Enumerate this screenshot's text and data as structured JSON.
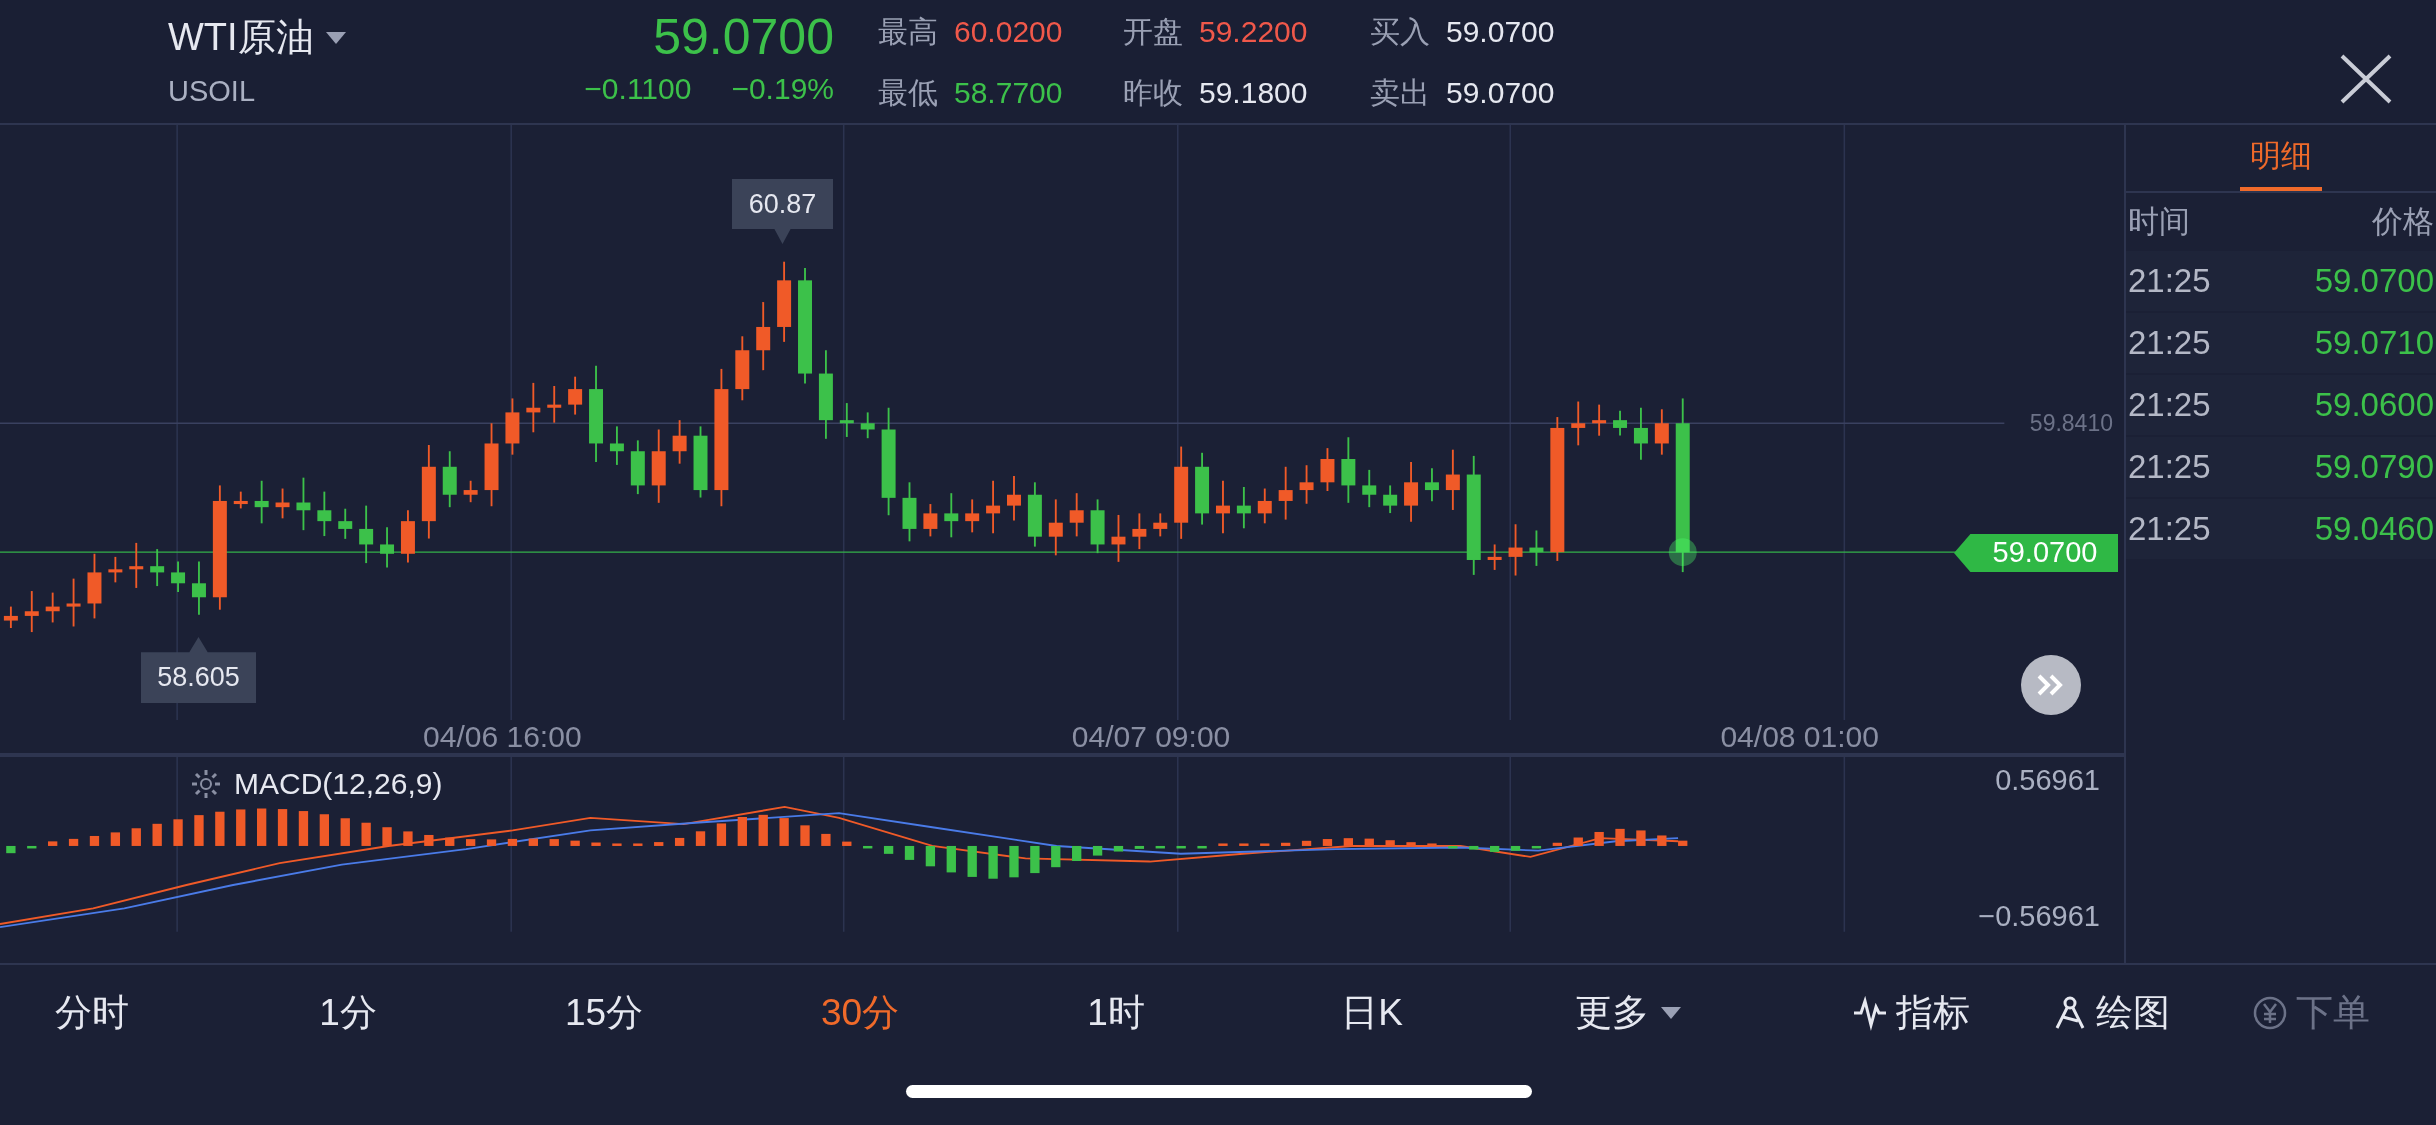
{
  "quote": {
    "symbol": "WTI原油",
    "code": "USOIL",
    "price": "59.0700",
    "change": "−0.1100",
    "change_pct": "−0.19%",
    "color": "#3cc14a"
  },
  "stats": [
    {
      "label": "最高",
      "value": "60.0200",
      "color": "#f0584a"
    },
    {
      "label": "开盘",
      "value": "59.2200",
      "color": "#f0584a"
    },
    {
      "label": "买入",
      "value": "59.0700",
      "color": "#e6e8f0"
    },
    {
      "label": "最低",
      "value": "58.7700",
      "color": "#3cc14a"
    },
    {
      "label": "昨收",
      "value": "59.1800",
      "color": "#e6e8f0"
    },
    {
      "label": "卖出",
      "value": "59.0700",
      "color": "#e6e8f0"
    }
  ],
  "chart": {
    "high_marker": "60.87",
    "low_marker": "58.605",
    "ref_line": "59.8410",
    "last_price": "59.0700",
    "x_labels": [
      "04/06 16:00",
      "04/07 09:00",
      "04/08 01:00"
    ]
  },
  "macd": {
    "title": "MACD(12,26,9)",
    "axis_max": "0.56961",
    "axis_min": "−0.56961"
  },
  "side_panel": {
    "tabs": [
      {
        "label": "明细",
        "selected": true
      }
    ],
    "columns": [
      "时间",
      "价格"
    ],
    "rows": [
      {
        "time": "21:25",
        "price": "59.0700"
      },
      {
        "time": "21:25",
        "price": "59.0710"
      },
      {
        "time": "21:25",
        "price": "59.0600"
      },
      {
        "time": "21:25",
        "price": "59.0790"
      },
      {
        "time": "21:25",
        "price": "59.0460"
      }
    ]
  },
  "periods": [
    {
      "label": "分时",
      "selected": false
    },
    {
      "label": "1分",
      "selected": false
    },
    {
      "label": "15分",
      "selected": false
    },
    {
      "label": "30分",
      "selected": true
    },
    {
      "label": "1时",
      "selected": false
    },
    {
      "label": "日K",
      "selected": false
    },
    {
      "label": "更多",
      "selected": false,
      "kind": "dropdown"
    }
  ],
  "tools": [
    {
      "label": "指标",
      "kind": "indicator",
      "disabled": false
    },
    {
      "label": "绘图",
      "kind": "draw",
      "disabled": false
    },
    {
      "label": "下单",
      "kind": "order",
      "disabled": true
    }
  ]
}
